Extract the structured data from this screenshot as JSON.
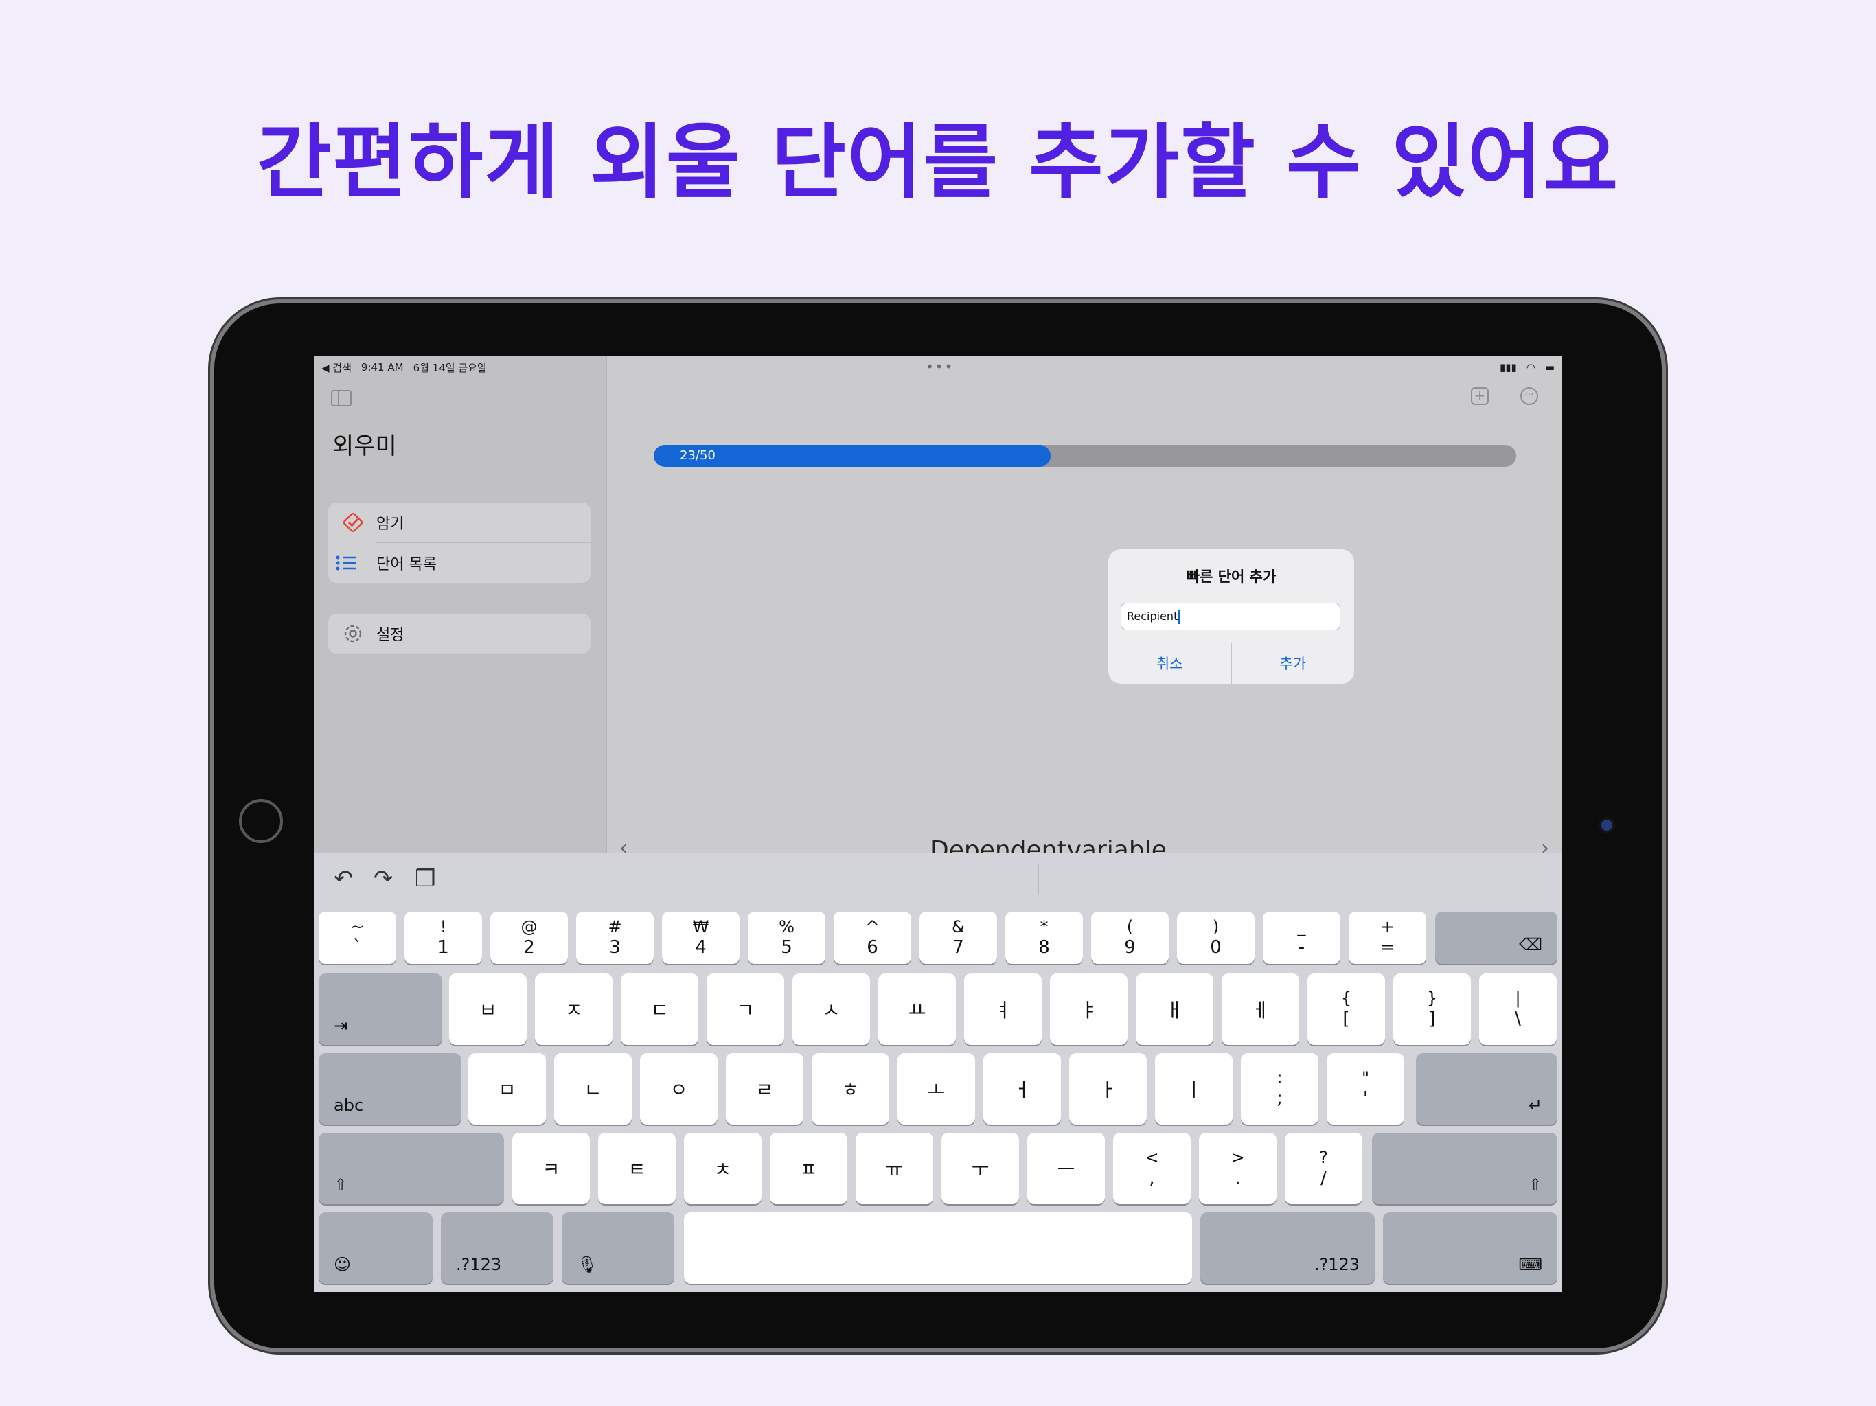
{
  "headline": "간편하게 외울 단어를 추가할 수 있어요",
  "status_bar": {
    "back_app": "◀ 검색",
    "time": "9:41 AM",
    "date": "6월 14일 금요일",
    "signal": "▮▮▮",
    "wifi": "◠",
    "battery": "▬"
  },
  "sidebar": {
    "title": "외우미",
    "items": [
      {
        "label": "암기",
        "icon": "memorize-check-icon"
      },
      {
        "label": "단어 목록",
        "icon": "list-icon"
      }
    ],
    "settings": {
      "label": "설정",
      "icon": "gear-icon"
    }
  },
  "toolbar": {
    "more_dots": "•••",
    "add": "+",
    "more": "···"
  },
  "progress": {
    "label": "23/50",
    "value": 0.46
  },
  "card_word": "Dependentvariable",
  "dialog": {
    "title": "빠른 단어 추가",
    "input_value": "Recipient",
    "cancel": "취소",
    "confirm": "추가"
  },
  "keyboard": {
    "tools": {
      "undo": "↶",
      "redo": "↷",
      "paste": "❐"
    },
    "row1": [
      {
        "t": "~",
        "b": "`"
      },
      {
        "t": "!",
        "b": "1"
      },
      {
        "t": "@",
        "b": "2"
      },
      {
        "t": "#",
        "b": "3"
      },
      {
        "t": "₩",
        "b": "4"
      },
      {
        "t": "%",
        "b": "5"
      },
      {
        "t": "^",
        "b": "6"
      },
      {
        "t": "&",
        "b": "7"
      },
      {
        "t": "*",
        "b": "8"
      },
      {
        "t": "(",
        "b": "9"
      },
      {
        "t": ")",
        "b": "0"
      },
      {
        "t": "_",
        "b": "-"
      },
      {
        "t": "+",
        "b": "="
      }
    ],
    "delete": "⌫",
    "tab": "⇥",
    "row2": [
      "ㅂ",
      "ㅈ",
      "ㄷ",
      "ㄱ",
      "ㅅ",
      "ㅛ",
      "ㅕ",
      "ㅑ",
      "ㅐ",
      "ㅔ"
    ],
    "row2_sym": [
      {
        "t": "{",
        "b": "["
      },
      {
        "t": "}",
        "b": "]"
      },
      {
        "t": "|",
        "b": "\\"
      }
    ],
    "abc": "abc",
    "row3": [
      "ㅁ",
      "ㄴ",
      "ㅇ",
      "ㄹ",
      "ㅎ",
      "ㅗ",
      "ㅓ",
      "ㅏ",
      "ㅣ"
    ],
    "row3_sym": [
      {
        "t": ":",
        "b": ";"
      },
      {
        "t": "\"",
        "b": "'"
      }
    ],
    "return": "↵",
    "shift": "⇧",
    "row4": [
      "ㅋ",
      "ㅌ",
      "ㅊ",
      "ㅍ",
      "ㅠ",
      "ㅜ",
      "ㅡ"
    ],
    "row4_sym": [
      {
        "t": "<",
        "b": ","
      },
      {
        "t": ">",
        "b": "."
      },
      {
        "t": "?",
        "b": "/"
      }
    ],
    "emoji": "☺",
    "num_left": ".?123",
    "mic": "🎙",
    "num_right": ".?123",
    "hide": "⌨"
  }
}
